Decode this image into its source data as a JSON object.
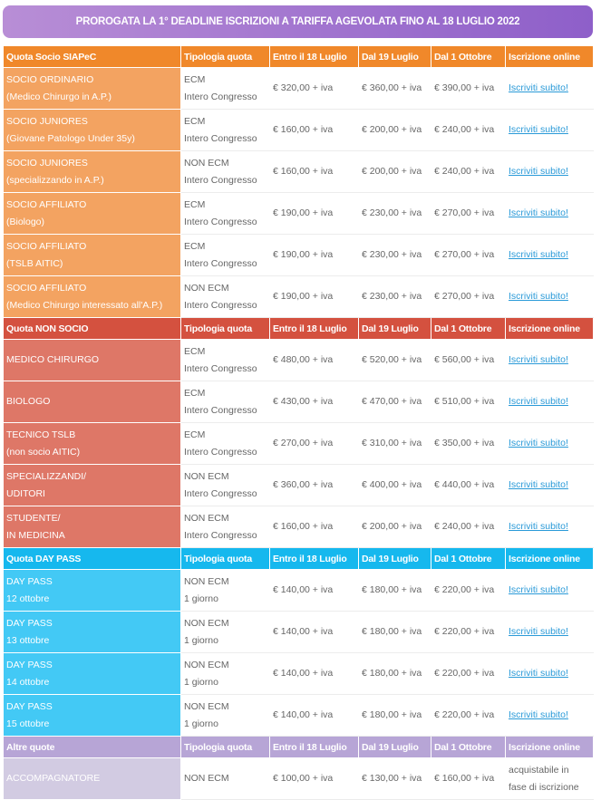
{
  "banner": "PROROGATA LA 1° DEADLINE ISCRIZIONI A TARIFFA AGEVOLATA FINO AL 18 LUGLIO 2022",
  "columns": [
    "Tipologia quota",
    "Entro il 18 Luglio",
    "Dal 19 Luglio",
    "Dal 1 Ottobre",
    "Iscrizione online"
  ],
  "colors": {
    "socio_head": "#f0882a",
    "socio_cell": "#f3a361",
    "nonsocio_head": "#d4513f",
    "nonsocio_cell": "#de7767",
    "daypass_head": "#16b8ee",
    "daypass_cell": "#43c9f5",
    "altre_head": "#b7a5d6",
    "altre_cell": "#d2cbe2"
  },
  "sections": [
    {
      "title": "Quota Socio SIAPeC",
      "key": "socio",
      "rows": [
        {
          "l1": "SOCIO ORDINARIO",
          "l2": "(Medico Chirurgo in A.P.)",
          "t1": "ECM",
          "t2": "Intero Congresso",
          "p1": "€ 320,00 + iva",
          "p2": "€ 360,00 + iva",
          "p3": "€ 390,00 + iva",
          "link": "Iscriviti subito!"
        },
        {
          "l1": "SOCIO JUNIORES",
          "l2": "(Giovane Patologo Under 35y)",
          "t1": "ECM",
          "t2": "Intero Congresso",
          "p1": "€ 160,00 + iva",
          "p2": "€ 200,00 + iva",
          "p3": "€ 240,00 + iva",
          "link": "Iscriviti subito!"
        },
        {
          "l1": "SOCIO JUNIORES",
          "l2": "(specializzando in A.P.)",
          "t1": "NON ECM",
          "t2": "Intero Congresso",
          "p1": "€ 160,00 + iva",
          "p2": "€ 200,00 + iva",
          "p3": "€ 240,00 + iva",
          "link": "Iscriviti subito!"
        },
        {
          "l1": "SOCIO AFFILIATO",
          "l2": "(Biologo)",
          "t1": "ECM",
          "t2": "Intero Congresso",
          "p1": "€ 190,00 + iva",
          "p2": "€ 230,00 + iva",
          "p3": "€ 270,00 + iva",
          "link": "Iscriviti subito!"
        },
        {
          "l1": "SOCIO AFFILIATO",
          "l2": "(TSLB AITIC)",
          "t1": "ECM",
          "t2": "Intero Congresso",
          "p1": "€ 190,00 + iva",
          "p2": "€ 230,00 + iva",
          "p3": "€ 270,00 + iva",
          "link": "Iscriviti subito!"
        },
        {
          "l1": "SOCIO AFFILIATO",
          "l2": "(Medico Chirurgo interessato all'A.P.)",
          "t1": "NON ECM",
          "t2": "Intero Congresso",
          "p1": "€ 190,00 + iva",
          "p2": "€ 230,00 + iva",
          "p3": "€ 270,00 + iva",
          "link": "Iscriviti subito!"
        }
      ]
    },
    {
      "title": "Quota NON SOCIO",
      "key": "nonsocio",
      "rows": [
        {
          "l1": "MEDICO CHIRURGO",
          "l2": "",
          "t1": "ECM",
          "t2": "Intero Congresso",
          "p1": "€ 480,00 + iva",
          "p2": "€ 520,00 + iva",
          "p3": "€ 560,00 + iva",
          "link": "Iscriviti subito!"
        },
        {
          "l1": "BIOLOGO",
          "l2": "",
          "t1": "ECM",
          "t2": "Intero Congresso",
          "p1": "€ 430,00 + iva",
          "p2": "€ 470,00 + iva",
          "p3": "€ 510,00 + iva",
          "link": "Iscriviti subito!"
        },
        {
          "l1": "TECNICO TSLB",
          "l2": "(non socio AITIC)",
          "t1": "ECM",
          "t2": "Intero Congresso",
          "p1": "€ 270,00 + iva",
          "p2": "€ 310,00 + iva",
          "p3": "€ 350,00 + iva",
          "link": "Iscriviti subito!"
        },
        {
          "l1": "SPECIALIZZANDI/",
          "l2": "UDITORI",
          "t1": "NON ECM",
          "t2": "Intero Congresso",
          "p1": "€ 360,00 + iva",
          "p2": "€ 400,00 + iva",
          "p3": "€ 440,00 + iva",
          "link": "Iscriviti subito!"
        },
        {
          "l1": "STUDENTE/",
          "l2": "IN MEDICINA",
          "t1": "NON ECM",
          "t2": "Intero Congresso",
          "p1": "€ 160,00 + iva",
          "p2": "€ 200,00 + iva",
          "p3": "€ 240,00 + iva",
          "link": "Iscriviti subito!"
        }
      ]
    },
    {
      "title": "Quota DAY PASS",
      "key": "daypass",
      "rows": [
        {
          "l1": "DAY PASS",
          "l2": "12 ottobre",
          "t1": "NON ECM",
          "t2": "1 giorno",
          "p1": "€ 140,00 + iva",
          "p2": "€ 180,00 + iva",
          "p3": "€ 220,00 + iva",
          "link": "Iscriviti subito!"
        },
        {
          "l1": "DAY PASS",
          "l2": "13 ottobre",
          "t1": "NON ECM",
          "t2": "1 giorno",
          "p1": "€ 140,00 + iva",
          "p2": "€ 180,00 + iva",
          "p3": "€ 220,00 + iva",
          "link": "Iscriviti subito!"
        },
        {
          "l1": "DAY PASS",
          "l2": "14 ottobre",
          "t1": "NON ECM",
          "t2": "1 giorno",
          "p1": "€ 140,00 + iva",
          "p2": "€ 180,00 + iva",
          "p3": "€ 220,00 + iva",
          "link": "Iscriviti subito!"
        },
        {
          "l1": "DAY PASS",
          "l2": "15 ottobre",
          "t1": "NON ECM",
          "t2": "1 giorno",
          "p1": "€ 140,00 + iva",
          "p2": "€ 180,00 + iva",
          "p3": "€ 220,00 + iva",
          "link": "Iscriviti subito!"
        }
      ]
    },
    {
      "title": "Altre quote",
      "key": "altre",
      "rows": [
        {
          "l1": "ACCOMPAGNATORE",
          "l2": "",
          "t1": "NON ECM",
          "t2": "",
          "p1": "€ 100,00 + iva",
          "p2": "€ 130,00 + iva",
          "p3": "€ 160,00 + iva",
          "link": "",
          "note1": "acquistabile in",
          "note2": "fase di iscrizione"
        }
      ]
    }
  ]
}
